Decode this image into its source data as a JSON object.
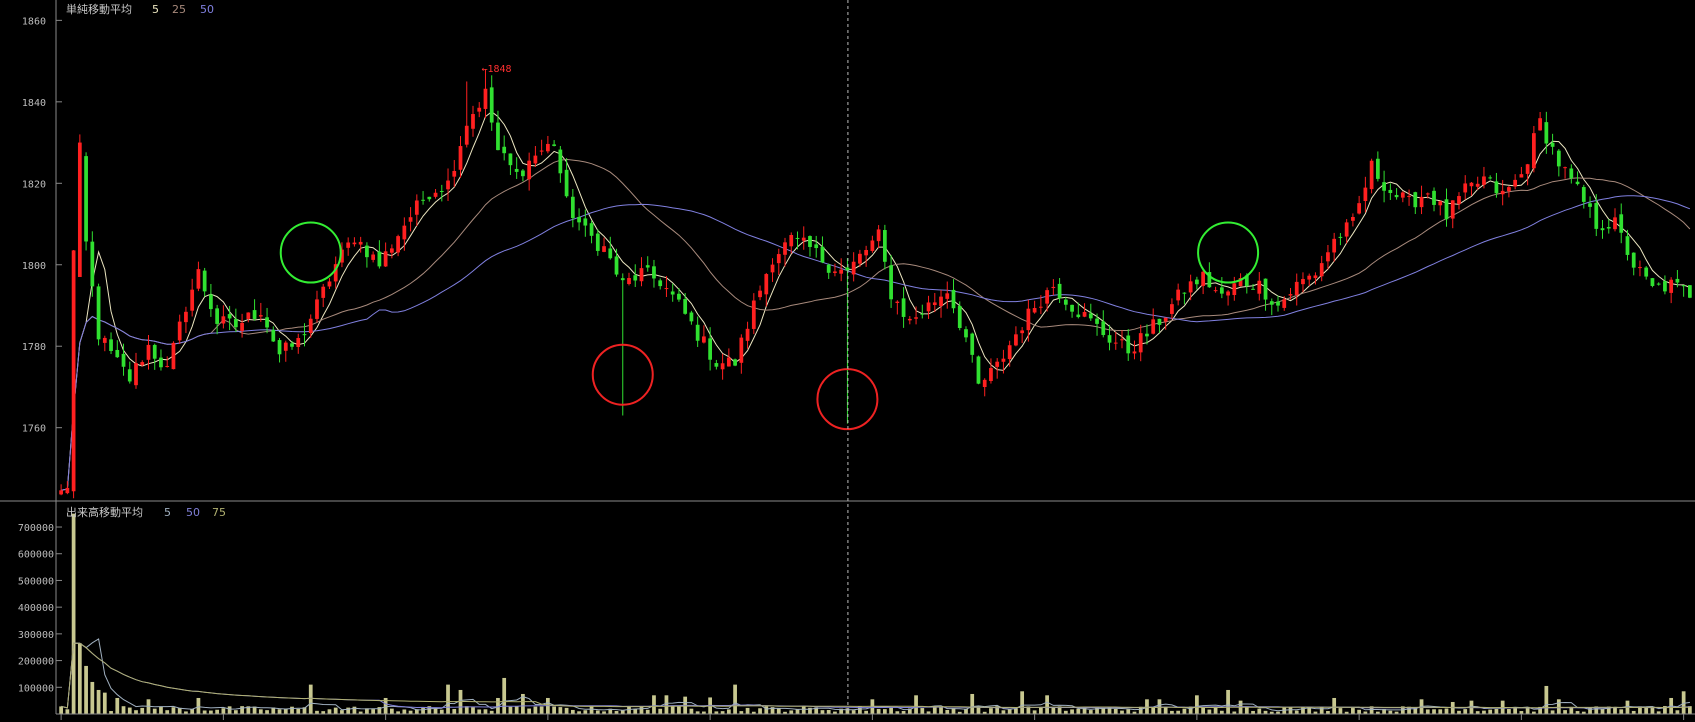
{
  "chart_data": [
    {
      "type": "candlestick",
      "title": "単純移動平均",
      "ma_periods": [
        "5",
        "25",
        "50"
      ],
      "y_ticks": [
        "1760",
        "1780",
        "1800",
        "1820",
        "1840",
        "1860"
      ],
      "ylim": [
        1742,
        1865
      ],
      "high_annotation": "←1848",
      "bars": 195,
      "price_anchors": [
        [
          0,
          1744
        ],
        [
          1,
          1746
        ],
        [
          2,
          1803
        ],
        [
          3,
          1825
        ],
        [
          4,
          1805
        ],
        [
          6,
          1783
        ],
        [
          8,
          1778
        ],
        [
          11,
          1772
        ],
        [
          14,
          1780
        ],
        [
          17,
          1774
        ],
        [
          20,
          1790
        ],
        [
          22,
          1798
        ],
        [
          25,
          1786
        ],
        [
          28,
          1785
        ],
        [
          32,
          1789
        ],
        [
          35,
          1778
        ],
        [
          38,
          1781
        ],
        [
          41,
          1790
        ],
        [
          44,
          1800
        ],
        [
          47,
          1807
        ],
        [
          51,
          1800
        ],
        [
          55,
          1810
        ],
        [
          59,
          1818
        ],
        [
          62,
          1820
        ],
        [
          65,
          1835
        ],
        [
          68,
          1842
        ],
        [
          70,
          1828
        ],
        [
          73,
          1822
        ],
        [
          76,
          1827
        ],
        [
          79,
          1830
        ],
        [
          81,
          1815
        ],
        [
          84,
          1808
        ],
        [
          87,
          1804
        ],
        [
          90,
          1795
        ],
        [
          93,
          1798
        ],
        [
          96,
          1796
        ],
        [
          99,
          1790
        ],
        [
          102,
          1783
        ],
        [
          105,
          1776
        ],
        [
          108,
          1776
        ],
        [
          111,
          1790
        ],
        [
          114,
          1802
        ],
        [
          117,
          1806
        ],
        [
          120,
          1804
        ],
        [
          123,
          1800
        ],
        [
          126,
          1798
        ],
        [
          128,
          1802
        ],
        [
          131,
          1807
        ],
        [
          133,
          1793
        ],
        [
          136,
          1786
        ],
        [
          139,
          1790
        ],
        [
          142,
          1794
        ],
        [
          145,
          1782
        ],
        [
          147,
          1770
        ],
        [
          150,
          1775
        ],
        [
          153,
          1783
        ],
        [
          156,
          1790
        ],
        [
          159,
          1795
        ],
        [
          162,
          1790
        ],
        [
          165,
          1786
        ],
        [
          168,
          1782
        ],
        [
          171,
          1779
        ],
        [
          174,
          1783
        ],
        [
          177,
          1788
        ],
        [
          180,
          1794
        ],
        [
          183,
          1797
        ],
        [
          186,
          1792
        ],
        [
          189,
          1796
        ],
        [
          192,
          1795
        ],
        [
          195,
          1790
        ],
        [
          198,
          1795
        ],
        [
          201,
          1798
        ],
        [
          204,
          1806
        ],
        [
          207,
          1810
        ],
        [
          210,
          1824
        ],
        [
          213,
          1818
        ],
        [
          216,
          1815
        ],
        [
          219,
          1818
        ],
        [
          222,
          1812
        ],
        [
          225,
          1818
        ],
        [
          228,
          1821
        ],
        [
          231,
          1817
        ],
        [
          234,
          1822
        ],
        [
          237,
          1835
        ],
        [
          240,
          1825
        ],
        [
          243,
          1818
        ],
        [
          246,
          1810
        ],
        [
          249,
          1810
        ],
        [
          252,
          1800
        ],
        [
          255,
          1794
        ],
        [
          258,
          1795
        ],
        [
          261,
          1793
        ]
      ],
      "ma_colors": [
        "#ece6c0",
        "#a88a7c",
        "#8080e0"
      ],
      "candle_up_color": "#ff2020",
      "candle_down_color": "#30e030",
      "markers": [
        {
          "bar": 40,
          "price": 1803,
          "color": "#33ee33"
        },
        {
          "bar": 90,
          "price": 1773,
          "color": "#ee2222"
        },
        {
          "bar": 126,
          "price": 1767,
          "color": "#ee2222"
        },
        {
          "bar": 187,
          "price": 1803,
          "color": "#33ee33"
        }
      ],
      "crosshair_bar": 126
    },
    {
      "type": "bar",
      "title": "出来高移動平均",
      "ma_periods": [
        "5",
        "50",
        "75"
      ],
      "y_ticks": [
        "100000",
        "200000",
        "300000",
        "400000",
        "500000",
        "600000",
        "700000"
      ],
      "ylim": [
        0,
        760000
      ],
      "bar_color": "#c8c890",
      "ma_colors": [
        "#a0b0c0",
        "#8080d8",
        "#b0b070"
      ],
      "volume_spikes": [
        [
          2,
          750000
        ],
        [
          3,
          265000
        ],
        [
          4,
          180000
        ],
        [
          5,
          120000
        ],
        [
          6,
          90000
        ],
        [
          7,
          80000
        ],
        [
          9,
          60000
        ],
        [
          14,
          55000
        ],
        [
          22,
          60000
        ],
        [
          40,
          110000
        ],
        [
          52,
          60000
        ],
        [
          62,
          110000
        ],
        [
          64,
          90000
        ],
        [
          70,
          60000
        ],
        [
          71,
          135000
        ],
        [
          74,
          75000
        ],
        [
          78,
          60000
        ],
        [
          95,
          70000
        ],
        [
          97,
          70000
        ],
        [
          100,
          65000
        ],
        [
          104,
          62000
        ],
        [
          108,
          110000
        ],
        [
          130,
          55000
        ],
        [
          137,
          70000
        ],
        [
          146,
          75000
        ],
        [
          154,
          85000
        ],
        [
          158,
          70000
        ],
        [
          174,
          55000
        ],
        [
          176,
          55000
        ],
        [
          182,
          70000
        ],
        [
          187,
          90000
        ],
        [
          189,
          50000
        ],
        [
          204,
          60000
        ],
        [
          218,
          55000
        ],
        [
          223,
          45000
        ],
        [
          226,
          50000
        ],
        [
          231,
          50000
        ],
        [
          238,
          105000
        ],
        [
          240,
          55000
        ],
        [
          251,
          50000
        ],
        [
          258,
          60000
        ],
        [
          260,
          85000
        ]
      ]
    }
  ]
}
